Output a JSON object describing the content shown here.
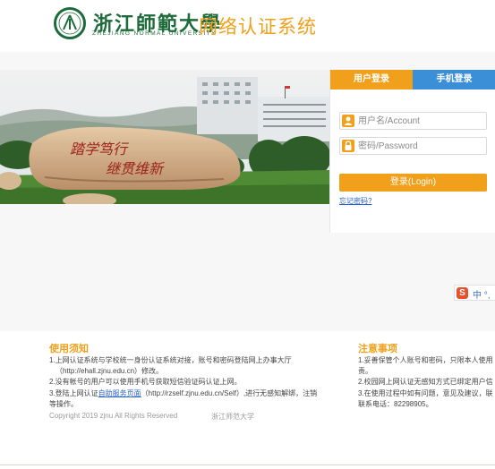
{
  "header": {
    "univ_name_cn": "浙江師範大學",
    "univ_name_en": "ZHEJIANG NORMAL UNIVERSITY",
    "system_title": "网络认证系统"
  },
  "banner": {
    "rock_inscription_line1": "踏学笃行",
    "rock_inscription_line2": "继贯维新"
  },
  "login": {
    "tabs": [
      {
        "label": "用户登录",
        "active": true
      },
      {
        "label": "手机登录",
        "active": false
      }
    ],
    "username_placeholder": "用户名/Account",
    "password_placeholder": "密码/Password",
    "login_button": "登录(Login)",
    "forgot_link": "忘记密码?"
  },
  "ime": {
    "label": "中",
    "extra": "°,"
  },
  "notice": {
    "title": "使用须知",
    "lines": [
      "1.上网认证系统与学校统一身份认证系统对接，账号和密码登陆网上办事大厅",
      "（http://ehall.zjnu.edu.cn）修改。",
      "2.没有帐号的用户可以使用手机号获取短信验证码认证上网。"
    ],
    "line3_prefix": "3.登陆上网认证",
    "line3_link": "自助服务页面",
    "line3_suffix": "（http://rzself.zjnu.edu.cn/Self）,进行无感知解绑，注销",
    "line4": "等操作。"
  },
  "attention": {
    "title": "注意事项",
    "lines": [
      "1.妥善保管个人账号和密码，只限本人使用",
      "责。",
      "2.校园网上网认证无感知方式已绑定用户信",
      "3.在使用过程中如有问题，意见及建议，联",
      "联系电话：82298905。"
    ]
  },
  "footer": {
    "copyright": "Copyright  2019 zjnu All Rights Reserved",
    "univ": "浙江师范大学"
  },
  "colors": {
    "brand_orange": "#f0a01a",
    "brand_blue": "#3b8fd6",
    "univ_green": "#1d6b3a",
    "link_blue": "#2a62c9"
  }
}
